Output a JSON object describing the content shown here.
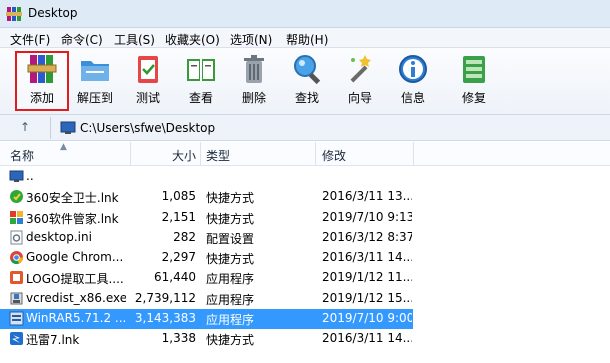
{
  "window": {
    "title": "Desktop"
  },
  "menu": [
    "文件(F)",
    "命令(C)",
    "工具(S)",
    "收藏夹(O)",
    "选项(N)",
    "帮助(H)"
  ],
  "toolbar": {
    "add": "添加",
    "extract": "解压到",
    "test": "测试",
    "view": "查看",
    "delete": "删除",
    "find": "查找",
    "wizard": "向导",
    "info": "信息",
    "repair": "修复"
  },
  "address": {
    "up_symbol": "↑",
    "path": "C:\\Users\\sfwe\\Desktop"
  },
  "columns": {
    "name": "名称",
    "size": "大小",
    "type": "类型",
    "modified": "修改"
  },
  "files": [
    {
      "name": "..",
      "size": "",
      "type": "",
      "modified": "",
      "icon": "folder-up-icon"
    },
    {
      "name": "360安全卫士.lnk",
      "size": "1,085",
      "type": "快捷方式",
      "modified": "2016/3/11 13...",
      "icon": "360-safe-icon"
    },
    {
      "name": "360软件管家.lnk",
      "size": "2,151",
      "type": "快捷方式",
      "modified": "2019/7/10 9:13",
      "icon": "360-software-icon"
    },
    {
      "name": "desktop.ini",
      "size": "282",
      "type": "配置设置",
      "modified": "2016/3/12 8:37",
      "icon": "ini-file-icon"
    },
    {
      "name": "Google Chrom...",
      "size": "2,297",
      "type": "快捷方式",
      "modified": "2016/3/11 14...",
      "icon": "chrome-icon"
    },
    {
      "name": "LOGO提取工具....",
      "size": "61,440",
      "type": "应用程序",
      "modified": "2019/1/12 11...",
      "icon": "logo-tool-icon"
    },
    {
      "name": "vcredist_x86.exe",
      "size": "2,739,112",
      "type": "应用程序",
      "modified": "2019/1/12 15...",
      "icon": "installer-icon"
    },
    {
      "name": "WinRAR5.71.2 ...",
      "size": "3,143,383",
      "type": "应用程序",
      "modified": "2019/7/10 9:00",
      "icon": "winrar-icon"
    },
    {
      "name": "迅雷7.lnk",
      "size": "1,338",
      "type": "快捷方式",
      "modified": "2016/3/11 14...",
      "icon": "xunlei-icon"
    }
  ],
  "colors": {
    "selection": "#3399ff",
    "highlight_border": "#e01c1c"
  }
}
